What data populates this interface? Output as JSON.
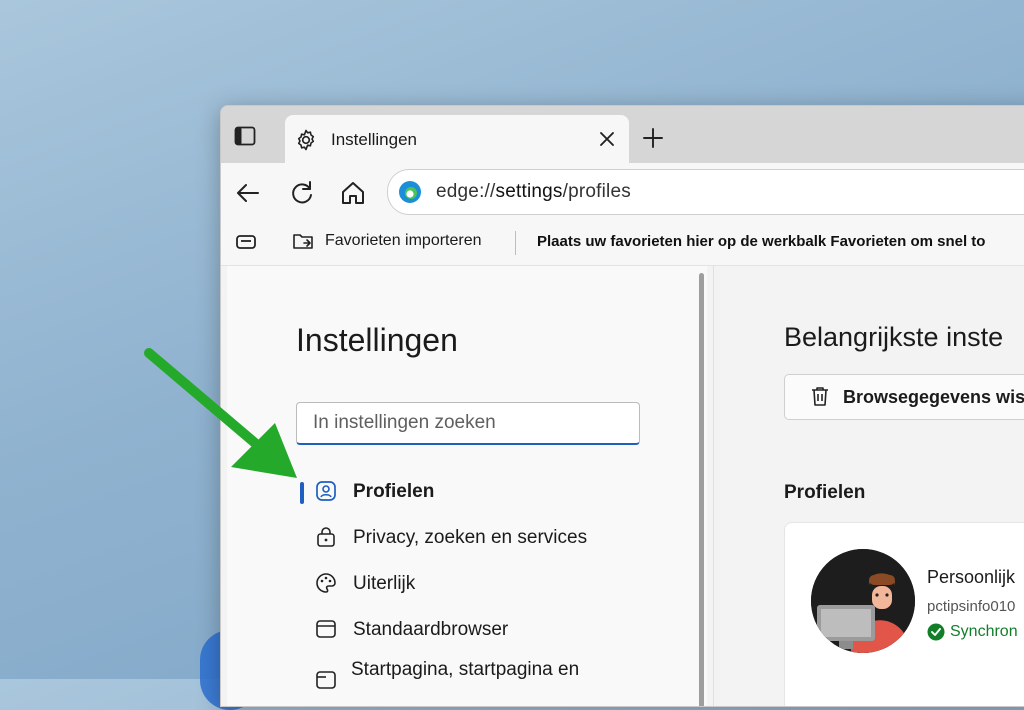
{
  "colors": {
    "accent": "#1f5fbf",
    "sync_green": "#127e2a",
    "arrow_green": "#25a92a"
  },
  "tab": {
    "title": "Instellingen",
    "icon": "gear-icon"
  },
  "address_bar": {
    "url_prefix": "edge://",
    "url_bold": "settings",
    "url_suffix": "/profiles"
  },
  "favorites_bar": {
    "import_label": "Favorieten importeren",
    "hint": "Plaats uw favorieten hier op de werkbalk Favorieten om snel to"
  },
  "sidebar": {
    "heading": "Instellingen",
    "search_placeholder": "In instellingen zoeken",
    "items": [
      {
        "label": "Profielen",
        "icon": "profile-icon",
        "active": true
      },
      {
        "label": "Privacy, zoeken en services",
        "icon": "lock-icon"
      },
      {
        "label": "Uiterlijk",
        "icon": "palette-icon"
      },
      {
        "label": "Standaardbrowser",
        "icon": "browser-window-icon"
      },
      {
        "label": "Startpagina, startpagina en",
        "icon": "home-page-icon"
      }
    ]
  },
  "main": {
    "heading": "Belangrijkste inste",
    "clear_button": "Browsegegevens wis",
    "section_title": "Profielen",
    "profile": {
      "name": "Persoonlijk",
      "email": "pctipsinfo010",
      "sync_status": "Synchron"
    }
  }
}
